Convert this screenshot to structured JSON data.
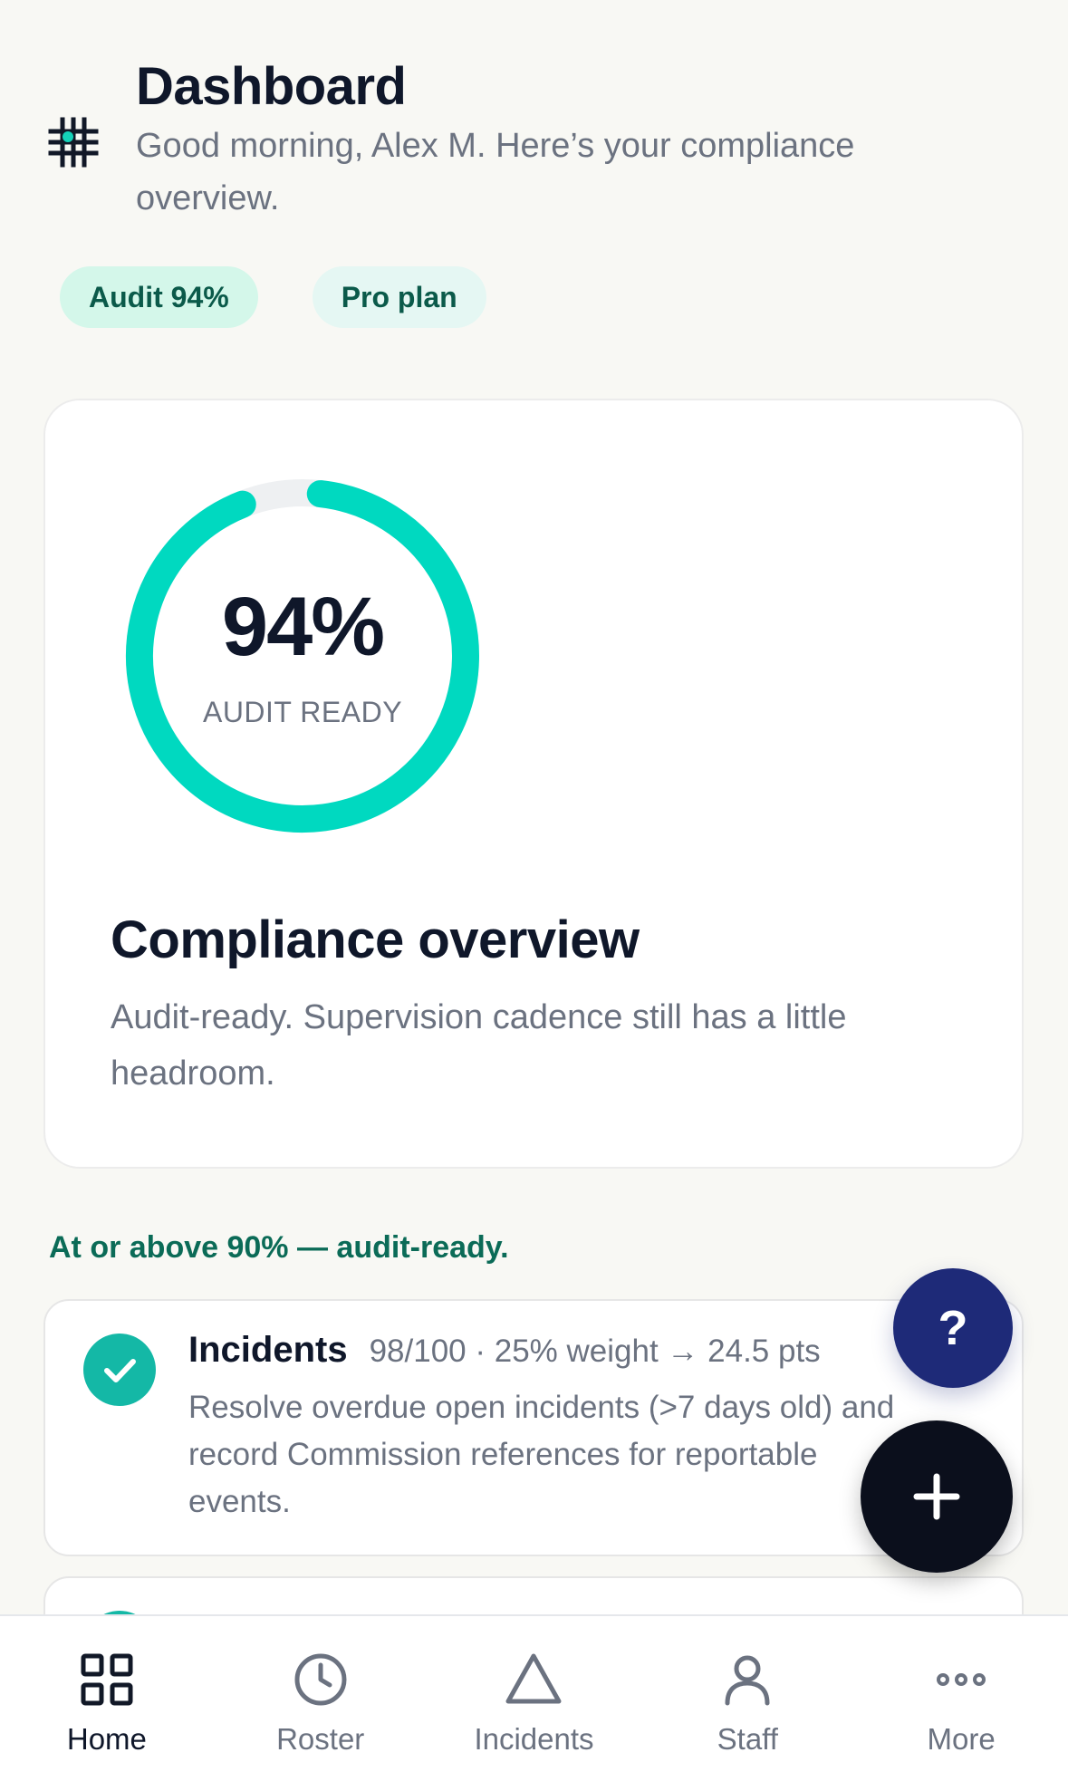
{
  "header": {
    "title": "Dashboard",
    "subtitle": "Good morning, Alex M. Here’s your compliance overview."
  },
  "chips": {
    "audit": "Audit 94%",
    "plan": "Pro plan"
  },
  "overview": {
    "gauge_value_text": "94%",
    "gauge_fraction": 0.94,
    "gauge_label": "AUDIT READY",
    "title": "Compliance overview",
    "description": "Audit-ready. Supervision cadence still has a little headroom."
  },
  "status_line": "At or above 90% — audit-ready.",
  "factors": [
    {
      "name": "Incidents",
      "meta": "98/100 · 25% weight → 24.5 pts",
      "description": "Resolve overdue open incidents (>7 days old) and record Commission references for reportable events."
    }
  ],
  "fab": {
    "help_label": "?"
  },
  "nav": [
    {
      "label": "Home",
      "icon": "grid-icon",
      "active": true
    },
    {
      "label": "Roster",
      "icon": "clock-icon",
      "active": false
    },
    {
      "label": "Incidents",
      "icon": "triangle-icon",
      "active": false
    },
    {
      "label": "Staff",
      "icon": "person-icon",
      "active": false
    },
    {
      "label": "More",
      "icon": "more-dots-icon",
      "active": false
    }
  ],
  "colors": {
    "accent": "#14b8a6",
    "gauge": "#00d9c0",
    "help_fab": "#1e2a78",
    "add_fab": "#0b0f1c"
  }
}
